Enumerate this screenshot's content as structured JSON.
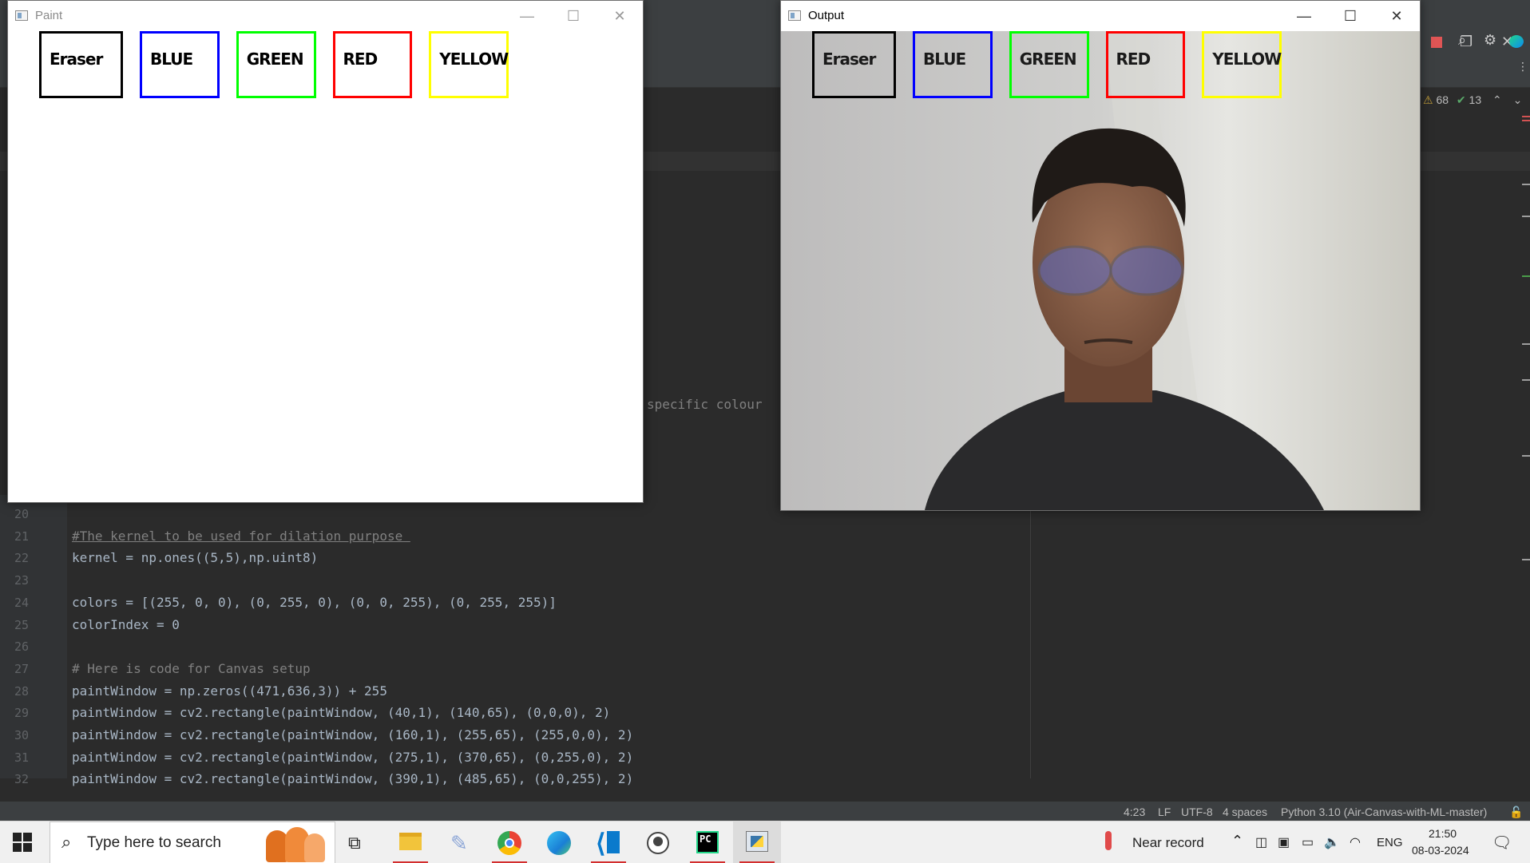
{
  "ide": {
    "inspections": {
      "warnings": "68",
      "ok": "13"
    },
    "stray_comment": "specific colour",
    "code_lines": [
      {
        "num": "20",
        "text": ""
      },
      {
        "num": "21",
        "text": "#The kernel to be used for dilation purpose "
      },
      {
        "num": "22",
        "text": "kernel = np.ones((5,5),np.uint8)"
      },
      {
        "num": "23",
        "text": ""
      },
      {
        "num": "24",
        "text": "colors = [(255, 0, 0), (0, 255, 0), (0, 0, 255), (0, 255, 255)]"
      },
      {
        "num": "25",
        "text": "colorIndex = 0"
      },
      {
        "num": "26",
        "text": ""
      },
      {
        "num": "27",
        "text": "# Here is code for Canvas setup"
      },
      {
        "num": "28",
        "text": "paintWindow = np.zeros((471,636,3)) + 255"
      },
      {
        "num": "29",
        "text": "paintWindow = cv2.rectangle(paintWindow, (40,1), (140,65), (0,0,0), 2)"
      },
      {
        "num": "30",
        "text": "paintWindow = cv2.rectangle(paintWindow, (160,1), (255,65), (255,0,0), 2)"
      },
      {
        "num": "31",
        "text": "paintWindow = cv2.rectangle(paintWindow, (275,1), (370,65), (0,255,0), 2)"
      },
      {
        "num": "32",
        "text": "paintWindow = cv2.rectangle(paintWindow, (390,1), (485,65), (0,0,255), 2)"
      }
    ],
    "status": {
      "position": "4:23",
      "line_sep": "LF",
      "encoding": "UTF-8",
      "indent": "4 spaces",
      "interpreter": "Python 3.10 (Air-Canvas-with-ML-master)"
    }
  },
  "paint_window": {
    "title": "Paint",
    "buttons": [
      {
        "label": "Eraser",
        "color": "#000000"
      },
      {
        "label": "BLUE",
        "color": "#0000ff"
      },
      {
        "label": "GREEN",
        "color": "#00ff00"
      },
      {
        "label": "RED",
        "color": "#ff0000"
      },
      {
        "label": "YELLOW",
        "color": "#ffff00"
      }
    ]
  },
  "output_window": {
    "title": "Output",
    "buttons": [
      {
        "label": "Eraser",
        "color": "#000000"
      },
      {
        "label": "BLUE",
        "color": "#0000ff"
      },
      {
        "label": "GREEN",
        "color": "#00ff00"
      },
      {
        "label": "RED",
        "color": "#ff0000"
      },
      {
        "label": "YELLOW",
        "color": "#ffff00"
      }
    ]
  },
  "window_controls": {
    "minimize": "—",
    "maximize": "☐",
    "close": "✕"
  },
  "taskbar": {
    "search_placeholder": "Type here to search",
    "weather": "Near record",
    "language": "ENG",
    "time": "21:50",
    "date": "08-03-2024",
    "apps": [
      "file-explorer",
      "paint-3d",
      "chrome",
      "edge",
      "vscode",
      "whatsapp",
      "pycharm",
      "python"
    ]
  }
}
